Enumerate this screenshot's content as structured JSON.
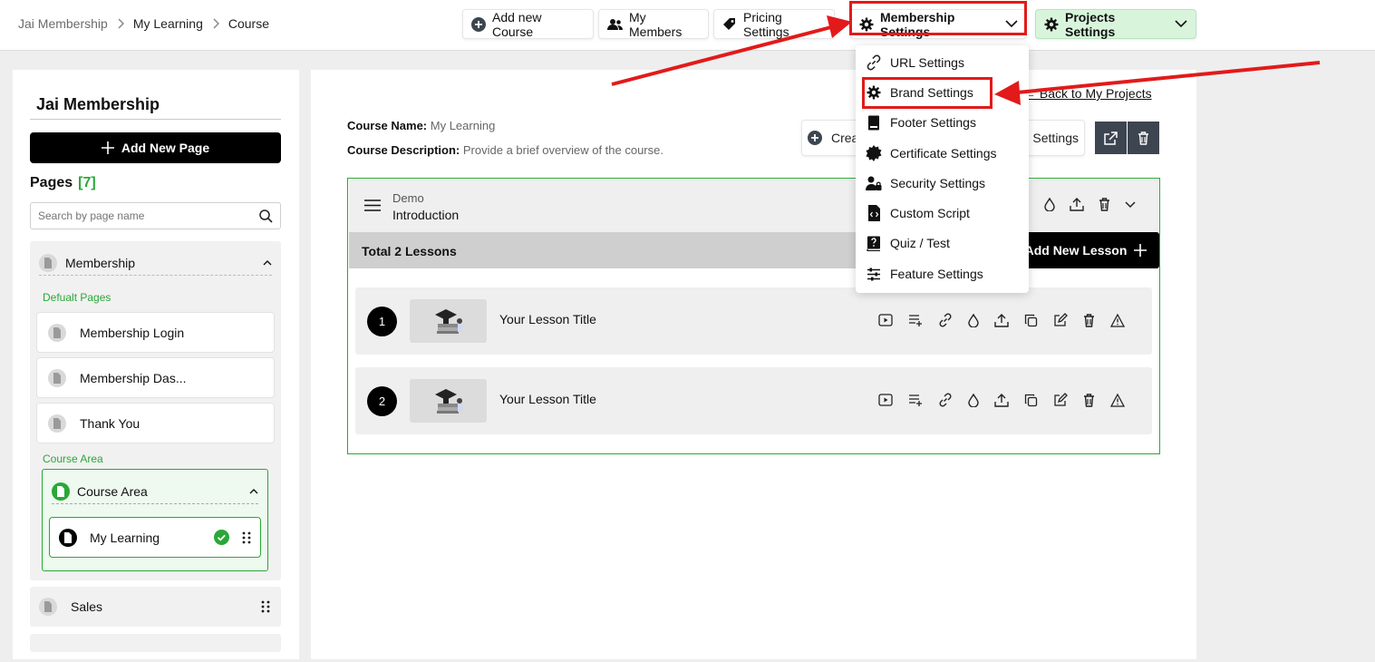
{
  "breadcrumb": [
    "Jai Membership",
    "My Learning",
    "Course"
  ],
  "toolbar": {
    "add_course": "Add new Course",
    "my_members": "My Members",
    "pricing": "Pricing Settings",
    "membership": "Membership Settings",
    "projects": "Projects Settings"
  },
  "dropdown": {
    "items": [
      "URL Settings",
      "Brand Settings",
      "Footer Settings",
      "Certificate Settings",
      "Security Settings",
      "Custom Script",
      "Quiz / Test",
      "Feature Settings"
    ]
  },
  "sidebar": {
    "project_title": "Jai Membership",
    "add_page": "Add New Page",
    "pages_label": "Pages",
    "pages_count": "[7]",
    "search_placeholder": "Search by page name",
    "group_label": "Membership",
    "default_pages_label": "Defualt Pages",
    "default_pages": [
      "Membership Login",
      "Membership Das...",
      "Thank You"
    ],
    "course_area_label": "Course Area",
    "course_area_title": "Course Area",
    "active_page": "My Learning",
    "sales": "Sales"
  },
  "main": {
    "back_link": "← Back to My Projects",
    "course_name_label": "Course Name:",
    "course_name": "My Learning",
    "course_desc_label": "Course Description:",
    "course_desc": "Provide a brief overview of the course.",
    "create_left": "Crea",
    "create_right": "e Settings",
    "module": {
      "label": "Demo",
      "title": "Introduction",
      "total_lessons": "Total 2 Lessons",
      "add_lesson": "Add New Lesson"
    },
    "lessons": [
      {
        "num": "1",
        "title": "Your Lesson Title"
      },
      {
        "num": "2",
        "title": "Your Lesson Title"
      }
    ]
  },
  "colors": {
    "accent_green": "#2aa837",
    "annotation_red": "#e21a1a",
    "dark_button": "#000000"
  }
}
